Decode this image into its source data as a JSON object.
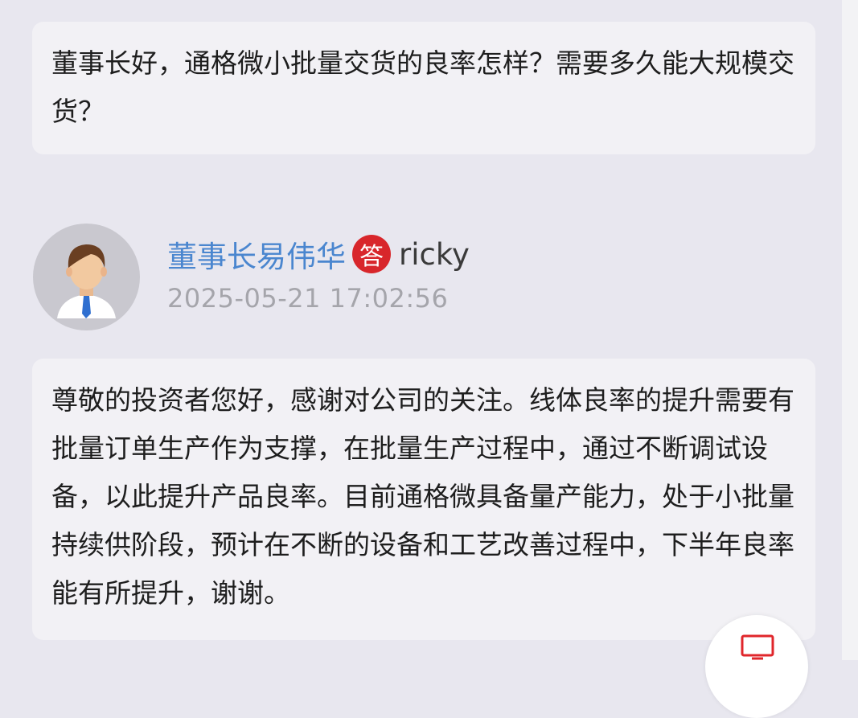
{
  "question": {
    "text": "董事长好，通格微小批量交货的良率怎样？需要多久能大规模交货？"
  },
  "reply": {
    "responder_name": "董事长易伟华",
    "badge_label": "答",
    "username": "ricky",
    "timestamp": "2025-05-21 17:02:56",
    "text": "尊敬的投资者您好，感谢对公司的关注。线体良率的提升需要有批量订单生产作为支撑，在批量生产过程中，通过不断调试设备，以此提升产品良率。目前通格微具备量产能力，处于小批量持续供阶段，预计在不断的设备和工艺改善过程中，下半年良率能有所提升，谢谢。"
  },
  "icons": {
    "avatar": "person-avatar-icon",
    "floating_button": "monitor-icon"
  },
  "colors": {
    "name": "#4a86cf",
    "badge": "#d8262b",
    "timestamp": "#a5a5ab",
    "background": "#e8e7ef",
    "bubble": "#f2f1f5"
  }
}
